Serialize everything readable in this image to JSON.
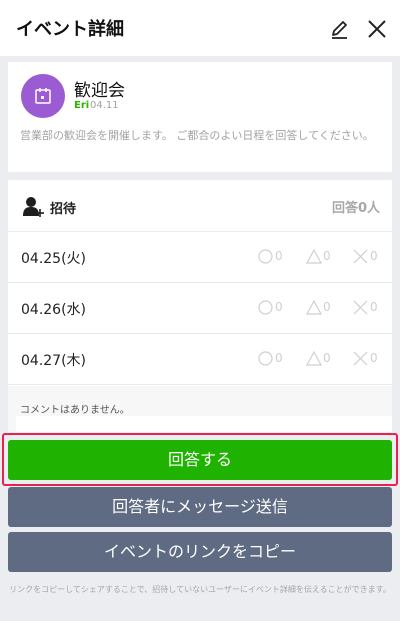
{
  "header": {
    "title": "イベント詳細",
    "edit_icon": "pencil-icon",
    "close_icon": "close-icon"
  },
  "event": {
    "title": "歓迎会",
    "author": "Eri",
    "date": "04.11",
    "description": "営業部の歓迎会を開催します。 ご都合のよい日程を回答してください。",
    "icon": "calendar-icon",
    "avatar_color": "#9a5bd3"
  },
  "poll": {
    "invite_label": "招待",
    "response_count": "回答0人",
    "dates": [
      {
        "label": "04.25(火)",
        "yes": "0",
        "maybe": "0",
        "no": "0"
      },
      {
        "label": "04.26(水)",
        "yes": "0",
        "maybe": "0",
        "no": "0"
      },
      {
        "label": "04.27(木)",
        "yes": "0",
        "maybe": "0",
        "no": "0"
      }
    ],
    "comments_text": "コメントはありません。"
  },
  "buttons": {
    "answer": "回答する",
    "message": "回答者にメッセージ送信",
    "copy_link": "イベントのリンクをコピー"
  },
  "footer_note": "リンクをコピーしてシェアすることで、招待していないユーザーにイベント詳細を伝えることができます。",
  "colors": {
    "accent_green": "#1fb200",
    "secondary": "#5f6a83",
    "highlight": "#e8224f"
  }
}
